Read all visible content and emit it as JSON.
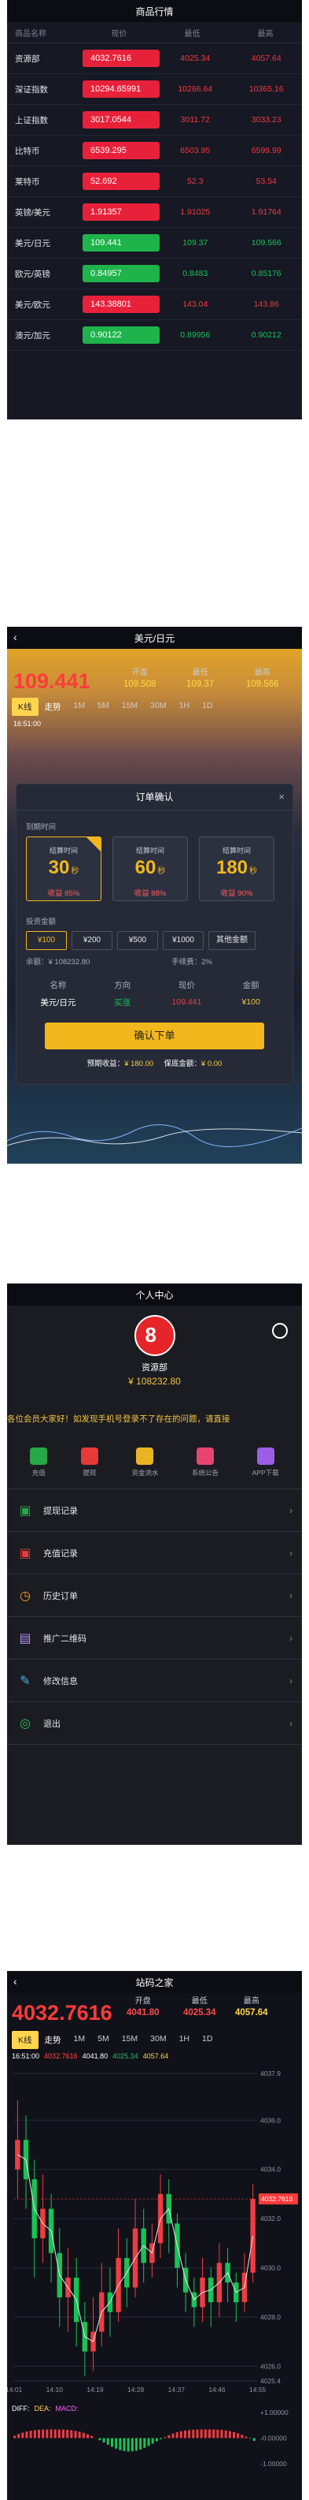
{
  "market": {
    "title": "商品行情",
    "columns": [
      "商品名称",
      "现价",
      "最低",
      "最高"
    ],
    "rows": [
      {
        "name": "资源部",
        "price": "4032.7616",
        "low": "4025.34",
        "high": "4057.64",
        "trend": "up"
      },
      {
        "name": "深证指数",
        "price": "10294.65991",
        "low": "10266.64",
        "high": "10365.16",
        "trend": "up"
      },
      {
        "name": "上证指数",
        "price": "3017.0544",
        "low": "3011.72",
        "high": "3033.23",
        "trend": "up"
      },
      {
        "name": "比特币",
        "price": "6539.295",
        "low": "6503.95",
        "high": "6599.99",
        "trend": "up"
      },
      {
        "name": "莱特币",
        "price": "52.692",
        "low": "52.3",
        "high": "53.54",
        "trend": "up"
      },
      {
        "name": "英镑/美元",
        "price": "1.91357",
        "low": "1.91025",
        "high": "1.91764",
        "trend": "up"
      },
      {
        "name": "美元/日元",
        "price": "109.441",
        "low": "109.37",
        "high": "109.566",
        "trend": "down"
      },
      {
        "name": "欧元/英镑",
        "price": "0.84957",
        "low": "0.8483",
        "high": "0.85176",
        "trend": "down"
      },
      {
        "name": "美元/欧元",
        "price": "143.38801",
        "low": "143.04",
        "high": "143.86",
        "trend": "up"
      },
      {
        "name": "澳元/加元",
        "price": "0.90122",
        "low": "0.89956",
        "high": "0.90212",
        "trend": "down"
      }
    ]
  },
  "order": {
    "title": "美元/日元",
    "price": "109.441",
    "stats": [
      {
        "label": "开盘",
        "value": "109.508"
      },
      {
        "label": "最低",
        "value": "109.37"
      },
      {
        "label": "最高",
        "value": "109.566"
      }
    ],
    "tabs": [
      "K线",
      "走势",
      "1M",
      "5M",
      "15M",
      "30M",
      "1H",
      "1D"
    ],
    "time_row": "16:51:00",
    "dialog": {
      "title": "订单确认",
      "close": "×",
      "section_time": "到期时间",
      "cards": [
        {
          "top": "结算时间",
          "num": "30",
          "unit": "秒",
          "profit": "收益 85%"
        },
        {
          "top": "结算时间",
          "num": "60",
          "unit": "秒",
          "profit": "收益 88%"
        },
        {
          "top": "结算时间",
          "num": "180",
          "unit": "秒",
          "profit": "收益 90%"
        }
      ],
      "section_amount": "投资金额",
      "amounts": [
        "¥100",
        "¥200",
        "¥500",
        "¥1000",
        "其他金额"
      ],
      "balance": "余额：¥ 108232.80",
      "fee": "手续费：2%",
      "table_head": [
        "名称",
        "方向",
        "现价",
        "金额"
      ],
      "table_row": [
        "美元/日元",
        "买涨",
        "109.441",
        "¥100"
      ],
      "confirm": "确认下单",
      "expect_label": "预期收益：",
      "expect_value": "¥ 180.00",
      "guarantee_label": "保底金额：",
      "guarantee_value": "¥ 0.00"
    }
  },
  "profile": {
    "title": "个人中心",
    "avatar_char": "8",
    "username": "资源部",
    "balance": "¥ 108232.80",
    "notice": "各位会员大家好！如发现手机号登录不了存在的问题，请直接",
    "quick": [
      "充值",
      "提现",
      "资金流水",
      "系统公告",
      "APP下载"
    ],
    "menu": [
      "提现记录",
      "充值记录",
      "历史订单",
      "推广二维码",
      "修改信息",
      "退出"
    ]
  },
  "chart": {
    "title": "站码之家",
    "price": "4032.7616",
    "open_label": "开盘",
    "open_value": "4041.80",
    "low_label": "最低",
    "low_value": "4025.34",
    "high_label": "最高",
    "high_value": "4057.64",
    "tabs": [
      "K线",
      "走势",
      "1M",
      "5M",
      "15M",
      "30M",
      "1H",
      "1D"
    ],
    "legend_time": "16:51:00",
    "legend_values": [
      "4032.7616",
      "4041.80",
      "4025.34",
      "4057.64"
    ],
    "diff_label": "DIFF:",
    "dea_label": "DEA:",
    "macd_label": "MACD:",
    "current_tag": "4032.7616"
  },
  "chart_data": {
    "type": "candlestick",
    "x_ticks": [
      "14:01",
      "14:10",
      "14:19",
      "14:28",
      "14:37",
      "14:46",
      "14:55"
    ],
    "y_ticks": [
      4037.9,
      4036.0,
      4034.0,
      4032.0,
      4030.0,
      4028.0,
      4026.0,
      4025.4
    ],
    "ylim": [
      4025.4,
      4037.9
    ],
    "macd_ticks": [
      "+1.00000",
      "-0.00000",
      "-1.00000"
    ],
    "candles": [
      {
        "o": 4034.0,
        "c": 4035.2,
        "h": 4036.8,
        "l": 4032.8
      },
      {
        "o": 4035.2,
        "c": 4033.6,
        "h": 4036.2,
        "l": 4032.4
      },
      {
        "o": 4033.6,
        "c": 4031.2,
        "h": 4034.4,
        "l": 4029.6
      },
      {
        "o": 4031.2,
        "c": 4032.4,
        "h": 4033.8,
        "l": 4030.2
      },
      {
        "o": 4032.4,
        "c": 4030.6,
        "h": 4033.0,
        "l": 4029.4
      },
      {
        "o": 4030.6,
        "c": 4028.8,
        "h": 4031.6,
        "l": 4027.6
      },
      {
        "o": 4028.8,
        "c": 4029.6,
        "h": 4030.8,
        "l": 4027.4
      },
      {
        "o": 4029.6,
        "c": 4027.8,
        "h": 4030.4,
        "l": 4026.8
      },
      {
        "o": 4027.8,
        "c": 4026.6,
        "h": 4028.6,
        "l": 4025.6
      },
      {
        "o": 4026.6,
        "c": 4027.4,
        "h": 4028.8,
        "l": 4025.8
      },
      {
        "o": 4027.4,
        "c": 4029.0,
        "h": 4030.2,
        "l": 4026.8
      },
      {
        "o": 4029.0,
        "c": 4028.2,
        "h": 4030.0,
        "l": 4027.2
      },
      {
        "o": 4028.2,
        "c": 4030.4,
        "h": 4031.6,
        "l": 4027.8
      },
      {
        "o": 4030.4,
        "c": 4029.2,
        "h": 4031.2,
        "l": 4028.4
      },
      {
        "o": 4029.2,
        "c": 4031.6,
        "h": 4032.8,
        "l": 4028.8
      },
      {
        "o": 4031.6,
        "c": 4030.2,
        "h": 4032.4,
        "l": 4029.4
      },
      {
        "o": 4030.2,
        "c": 4031.0,
        "h": 4031.8,
        "l": 4029.6
      },
      {
        "o": 4031.0,
        "c": 4033.0,
        "h": 4033.8,
        "l": 4030.4
      },
      {
        "o": 4033.0,
        "c": 4031.8,
        "h": 4033.6,
        "l": 4030.6
      },
      {
        "o": 4031.8,
        "c": 4030.0,
        "h": 4032.2,
        "l": 4029.2
      },
      {
        "o": 4030.0,
        "c": 4029.0,
        "h": 4030.6,
        "l": 4028.2
      },
      {
        "o": 4029.0,
        "c": 4028.4,
        "h": 4029.6,
        "l": 4027.6
      },
      {
        "o": 4028.4,
        "c": 4029.6,
        "h": 4030.4,
        "l": 4027.8
      },
      {
        "o": 4029.6,
        "c": 4028.6,
        "h": 4030.0,
        "l": 4027.6
      },
      {
        "o": 4028.6,
        "c": 4030.2,
        "h": 4031.0,
        "l": 4028.0
      },
      {
        "o": 4030.2,
        "c": 4029.4,
        "h": 4030.8,
        "l": 4028.6
      },
      {
        "o": 4029.4,
        "c": 4028.6,
        "h": 4029.8,
        "l": 4027.8
      },
      {
        "o": 4028.6,
        "c": 4029.8,
        "h": 4030.6,
        "l": 4028.2
      },
      {
        "o": 4029.8,
        "c": 4032.8,
        "h": 4033.4,
        "l": 4029.4
      }
    ]
  },
  "colors": {
    "up": "#ef3b43",
    "down": "#19c257",
    "accent": "#f2b71c"
  }
}
